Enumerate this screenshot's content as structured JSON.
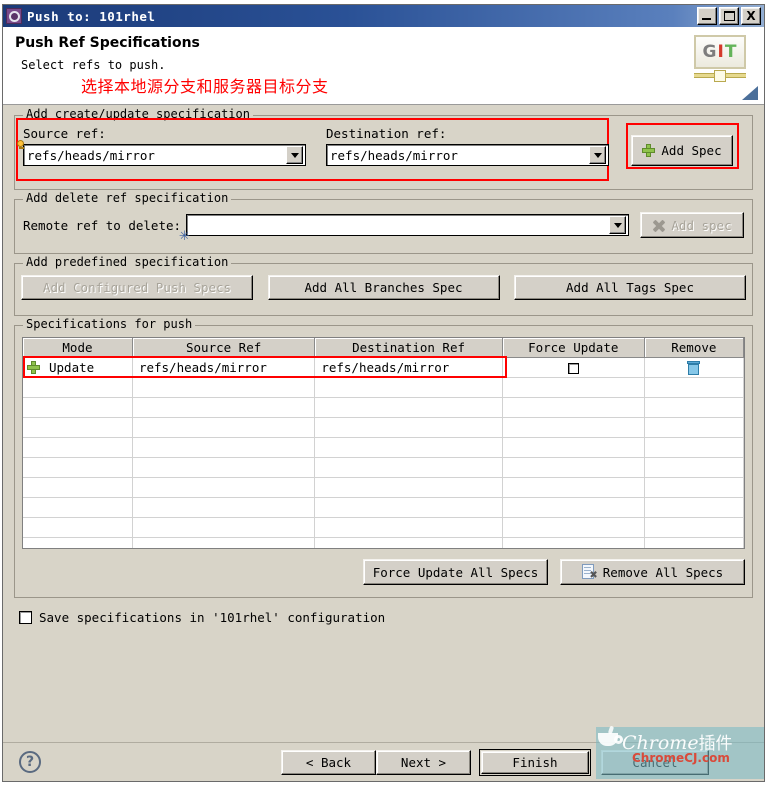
{
  "window": {
    "title": "Push to: 101rhel",
    "icon": "gear-icon",
    "controls": {
      "minimize": "_",
      "maximize": "□",
      "close": "X"
    }
  },
  "banner": {
    "title": "Push Ref Specifications",
    "subtitle": "Select refs to push.",
    "annotation_cn": "选择本地源分支和服务器目标分支",
    "logo_text": {
      "g": "G",
      "i": "I",
      "t": "T"
    }
  },
  "create_update_group": {
    "legend": "Add create/update specification",
    "source_label": "Source ref:",
    "source_value": "refs/heads/mirror",
    "destination_label": "Destination ref:",
    "destination_value": "refs/heads/mirror",
    "add_spec_label": "Add Spec"
  },
  "delete_group": {
    "legend": "Add delete ref specification",
    "remote_label": "Remote ref to delete:",
    "remote_value": "",
    "add_spec_label": "Add spec"
  },
  "predefined_group": {
    "legend": "Add predefined specification",
    "configured_push_specs": "Add Configured Push Specs",
    "all_branches_spec": "Add All Branches Spec",
    "all_tags_spec": "Add All Tags Spec"
  },
  "specifications": {
    "legend": "Specifications for push",
    "columns": [
      "Mode",
      "Source Ref",
      "Destination Ref",
      "Force Update",
      "Remove"
    ],
    "rows": [
      {
        "mode": "Update",
        "source_ref": "refs/heads/mirror",
        "destination_ref": "refs/heads/mirror",
        "force_update": false,
        "remove_icon": "trash-icon"
      }
    ],
    "empty_row_count": 9,
    "force_update_all_label": "Force Update All Specs",
    "remove_all_label": "Remove All Specs"
  },
  "save_config": {
    "label": "Save specifications in '101rhel' configuration",
    "checked": false
  },
  "footer": {
    "help": "?",
    "back": "< Back",
    "next": "Next >",
    "finish": "Finish",
    "cancel": "Cancel"
  },
  "watermark": {
    "line1": "Chrome",
    "line1_cn": "插件",
    "line2": "ChromeCJ.com"
  },
  "colors": {
    "titlebar_start": "#1b3a78",
    "dialog_bg": "#d8d4c8",
    "highlight_red": "#ff0000",
    "accent_green": "#8fc34c",
    "watermark_teal": "#7abac4"
  }
}
